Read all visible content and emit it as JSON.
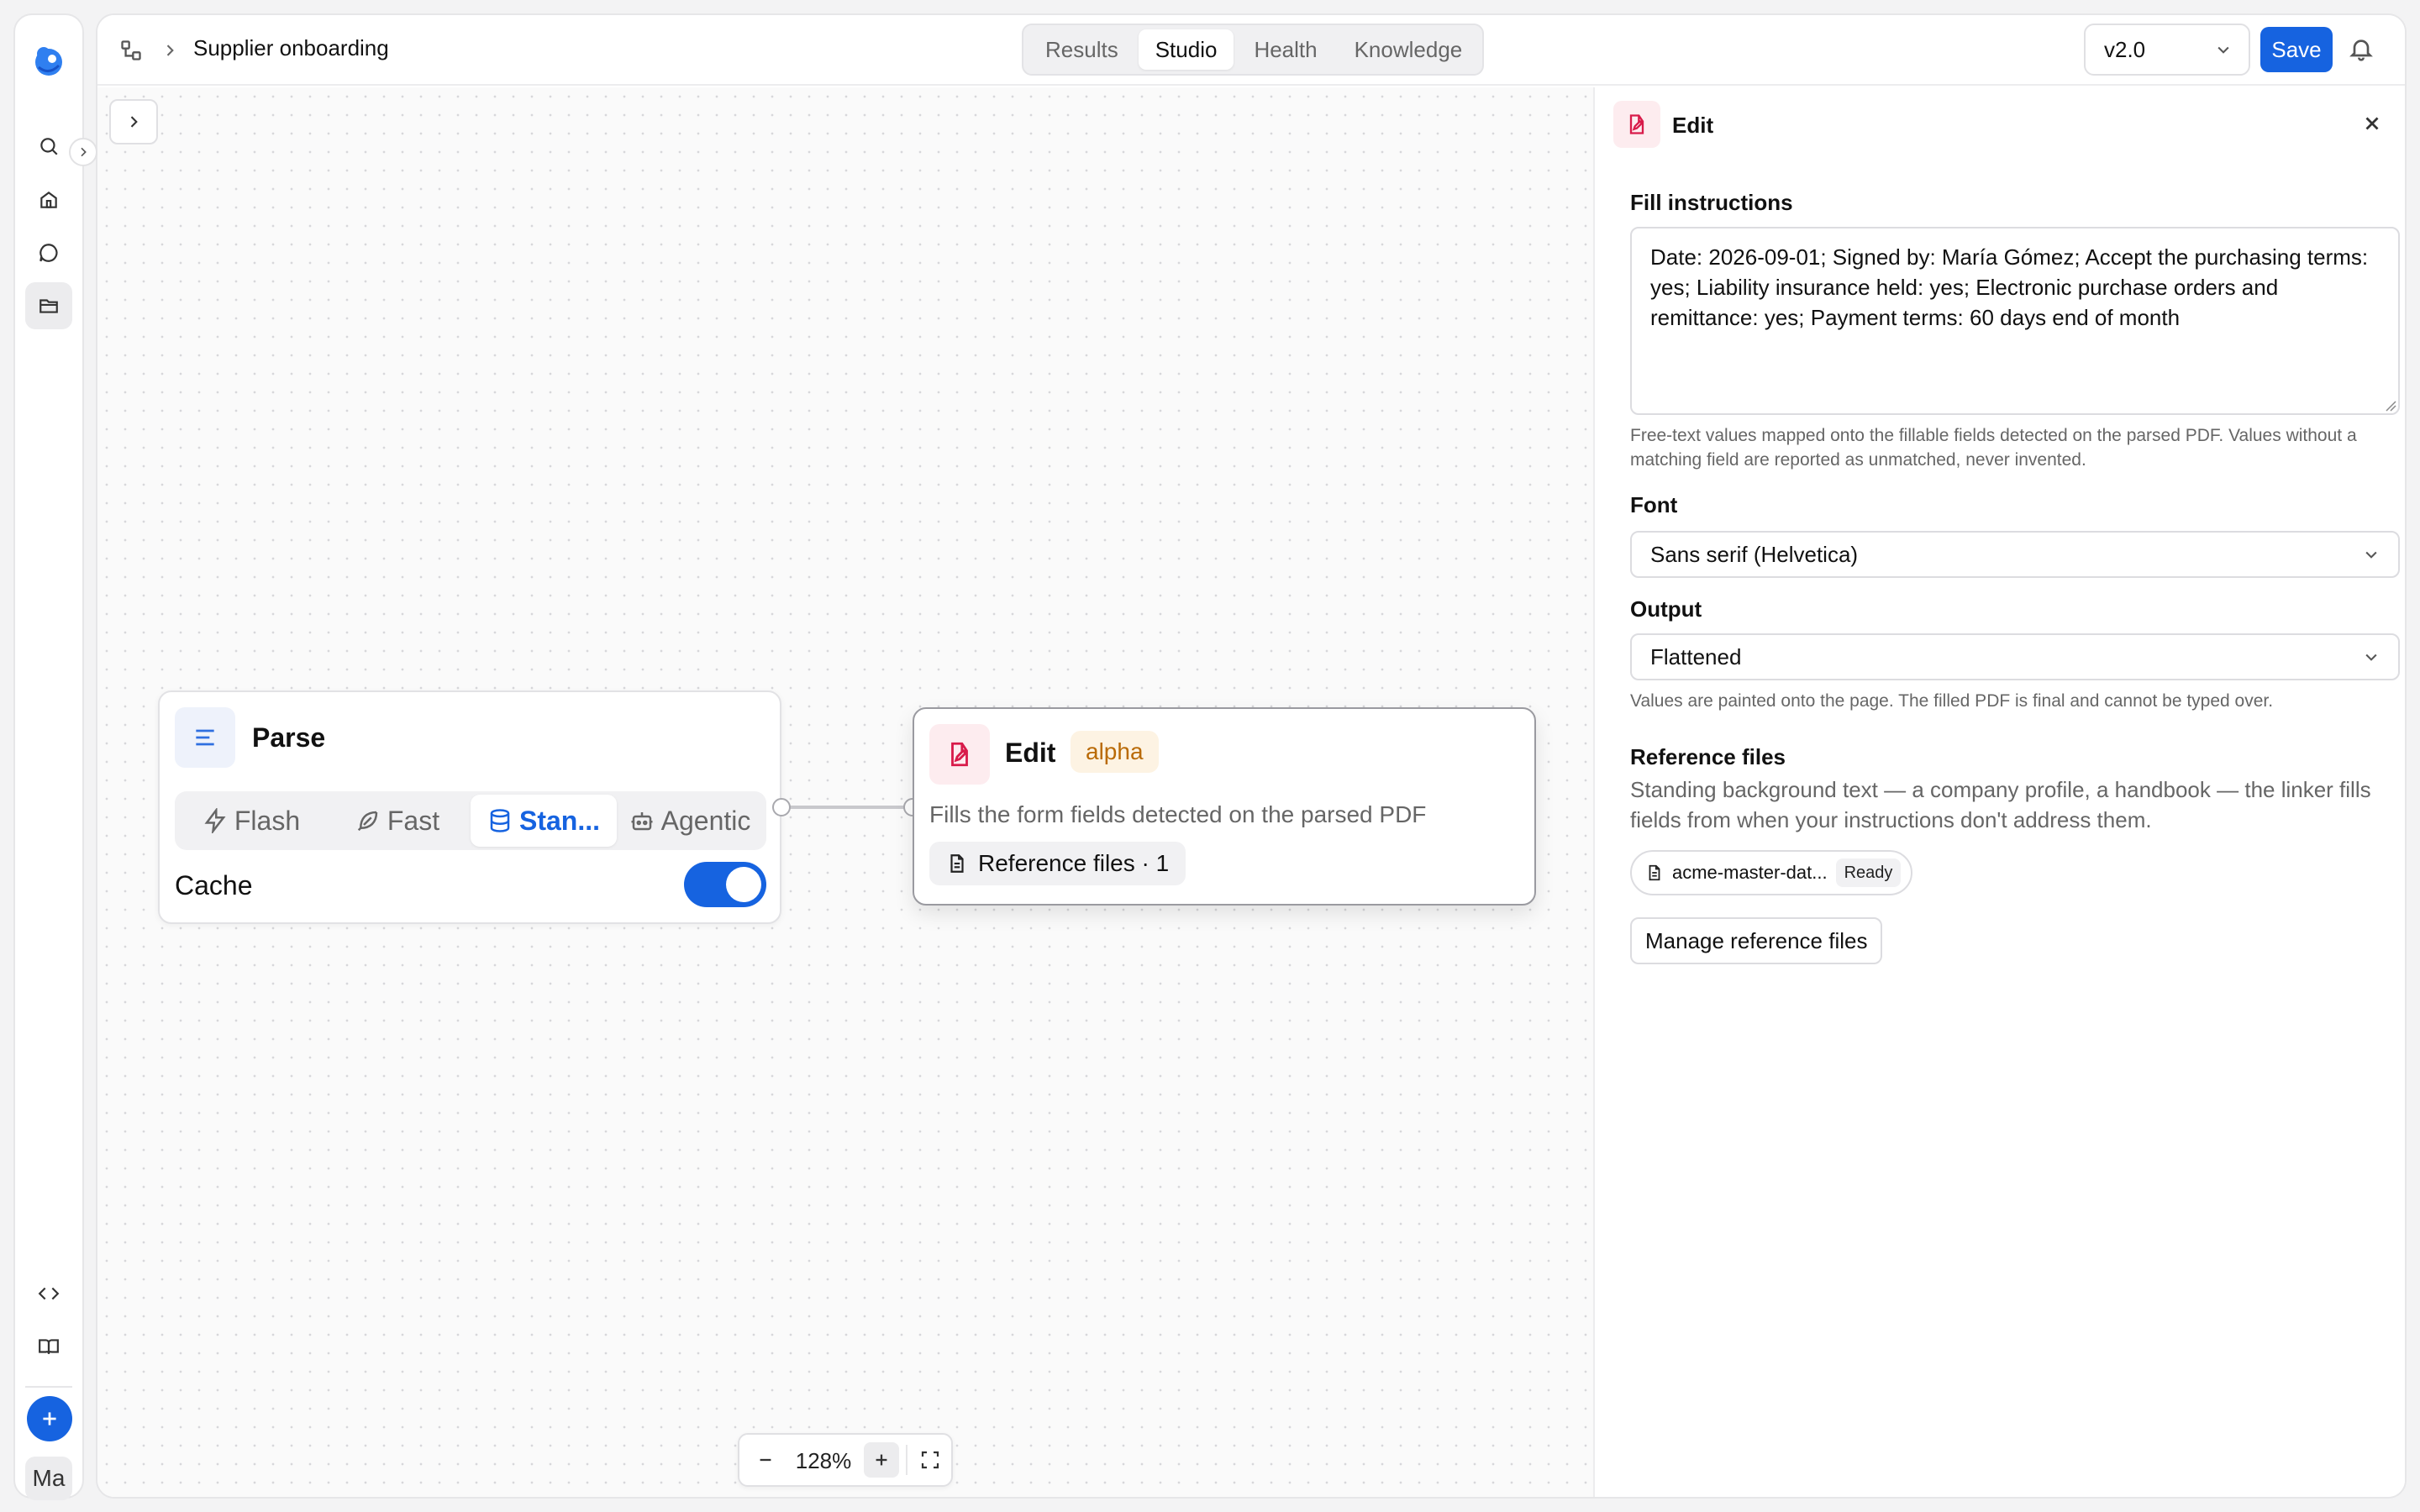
{
  "header": {
    "breadcrumb_title": "Supplier onboarding",
    "tabs": [
      {
        "label": "Results",
        "active": false
      },
      {
        "label": "Studio",
        "active": true
      },
      {
        "label": "Health",
        "active": false
      },
      {
        "label": "Knowledge",
        "active": false
      }
    ],
    "version": "v2.0",
    "save_label": "Save"
  },
  "sidebar": {
    "avatar_initials": "Ma",
    "icons": [
      "logo-icon",
      "search-icon",
      "home-icon",
      "chat-icon",
      "folder-icon",
      "code-icon",
      "book-icon",
      "plus-icon"
    ]
  },
  "canvas": {
    "parse_node": {
      "title": "Parse",
      "modes": [
        "Flash",
        "Fast",
        "Stan...",
        "Agentic"
      ],
      "active_mode": "Stan...",
      "cache_label": "Cache",
      "cache_enabled": true
    },
    "edit_node": {
      "title": "Edit",
      "badge": "alpha",
      "description": "Fills the form fields detected on the parsed PDF",
      "reference_chip": "Reference files · 1"
    },
    "zoom": "128%"
  },
  "panel": {
    "title": "Edit",
    "fill_instructions_label": "Fill instructions",
    "fill_instructions_value": "Date: 2026-09-01; Signed by: María Gómez; Accept the purchasing terms: yes; Liability insurance held: yes; Electronic purchase orders and remittance: yes; Payment terms: 60 days end of month",
    "fill_help": "Free-text values mapped onto the fillable fields detected on the parsed PDF. Values without a matching field are reported as unmatched, never invented.",
    "font_label": "Font",
    "font_value": "Sans serif (Helvetica)",
    "output_label": "Output",
    "output_value": "Flattened",
    "output_help": "Values are painted onto the page. The filled PDF is final and cannot be typed over.",
    "reference_label": "Reference files",
    "reference_desc": "Standing background text — a company profile, a handbook — the linker fills fields from when your instructions don't address them.",
    "file_name": "acme-master-dat...",
    "file_status": "Ready",
    "manage_label": "Manage reference files"
  },
  "colors": {
    "accent": "#1663e0",
    "edit_accent": "#d81b4a",
    "alpha_badge_bg": "#fdf3e3",
    "alpha_badge_text": "#b96a06"
  }
}
